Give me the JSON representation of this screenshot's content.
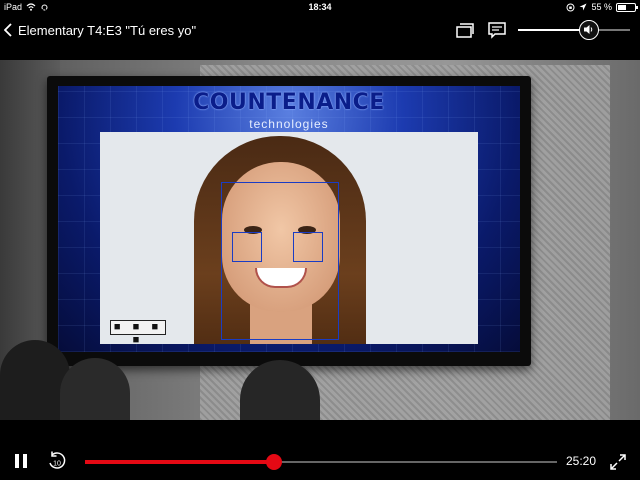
{
  "status_bar": {
    "device": "iPad",
    "time": "18:34",
    "battery_text": "55 %",
    "battery_level": 0.55
  },
  "player": {
    "title": "Elementary  T4:E3 \"Tú eres yo\"",
    "volume_level": 0.63,
    "progress": 0.4,
    "remaining_time": "25:20",
    "rewind_seconds": "10"
  },
  "screen": {
    "brand": "COUNTENANCE",
    "brand_sub": "technologies",
    "detect_label": "■ ■ ■ ■"
  },
  "icons": {
    "back": "chevron-left-icon",
    "episodes": "episodes-icon",
    "subtitles": "subtitles-icon",
    "volume": "speaker-icon",
    "pause": "pause-icon",
    "rewind": "rewind-10-icon",
    "fullscreen": "fullscreen-icon"
  },
  "colors": {
    "accent": "#e50914",
    "text": "#ffffff"
  }
}
